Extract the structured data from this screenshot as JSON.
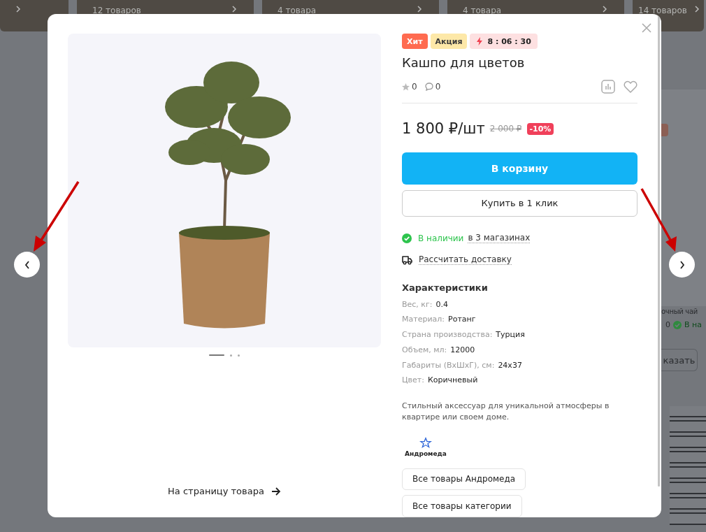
{
  "background": {
    "categories": [
      {
        "count": "12 товаров"
      },
      {
        "count": "4 товара"
      },
      {
        "count": "4 товара"
      },
      {
        "count": "14 товаров"
      }
    ],
    "product": {
      "title": "очный чай",
      "comments": "0",
      "stock": "В на",
      "button": "казать"
    }
  },
  "modal": {
    "badges": [
      {
        "kind": "hit",
        "label": "Хит"
      },
      {
        "kind": "sale",
        "label": "Акция"
      },
      {
        "kind": "timer",
        "label": "8 : 06 : 30"
      }
    ],
    "title": "Кашпо для цветов",
    "rating": "0",
    "reviews": "0",
    "price": "1 800 ₽/шт",
    "old_price": "2 000 ₽",
    "discount": "-10%",
    "cart_button": "В корзину",
    "one_click_button": "Купить в 1 клик",
    "availability": {
      "status": "В наличии",
      "stores": "в 3 магазинах"
    },
    "delivery": "Рассчитать доставку",
    "specs_title": "Характеристики",
    "specs": [
      {
        "name": "Вес, кг:",
        "value": "0.4"
      },
      {
        "name": "Материал:",
        "value": "Ротанг"
      },
      {
        "name": "Страна производства:",
        "value": "Турция"
      },
      {
        "name": "Объем, мл:",
        "value": "12000"
      },
      {
        "name": "Габариты (ВхШхГ), см:",
        "value": "24x37"
      },
      {
        "name": "Цвет:",
        "value": "Коричневый"
      }
    ],
    "description": "Стильный аксессуар для уникальной атмосферы в квартире или своем доме.",
    "brand": "Андромеда",
    "brand_buttons": [
      "Все товары Андромеда",
      "Все товары категории"
    ],
    "gallery_dots": [
      {
        "selected": true
      },
      {
        "selected": false
      },
      {
        "selected": false
      }
    ],
    "product_link": "На страницу товара"
  }
}
